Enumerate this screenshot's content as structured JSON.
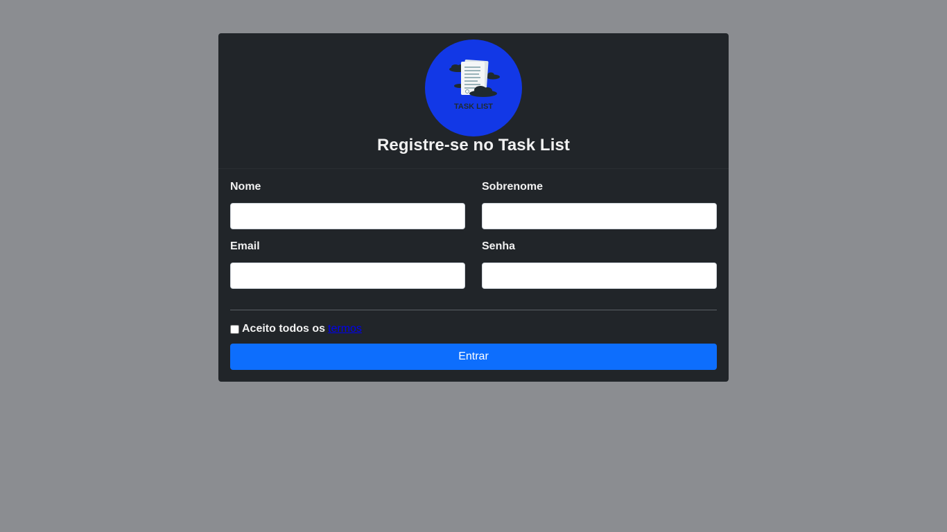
{
  "header": {
    "logo_text": "TASK LIST",
    "title": "Registre-se no Task List"
  },
  "form": {
    "first_name": {
      "label": "Nome",
      "value": "",
      "placeholder": ""
    },
    "last_name": {
      "label": "Sobrenome",
      "value": "",
      "placeholder": ""
    },
    "email": {
      "label": "Email",
      "value": "",
      "placeholder": ""
    },
    "password": {
      "label": "Senha",
      "value": "",
      "placeholder": ""
    },
    "terms": {
      "checked": false,
      "text": "Aceito todos os",
      "link_text": "termos"
    },
    "submit_label": "Entrar"
  },
  "colors": {
    "page_background": "#8b8d91",
    "card_background": "#212529",
    "logo_background": "#1238e6",
    "primary_button": "#0d6efd",
    "terms_link": "#0000ee"
  }
}
